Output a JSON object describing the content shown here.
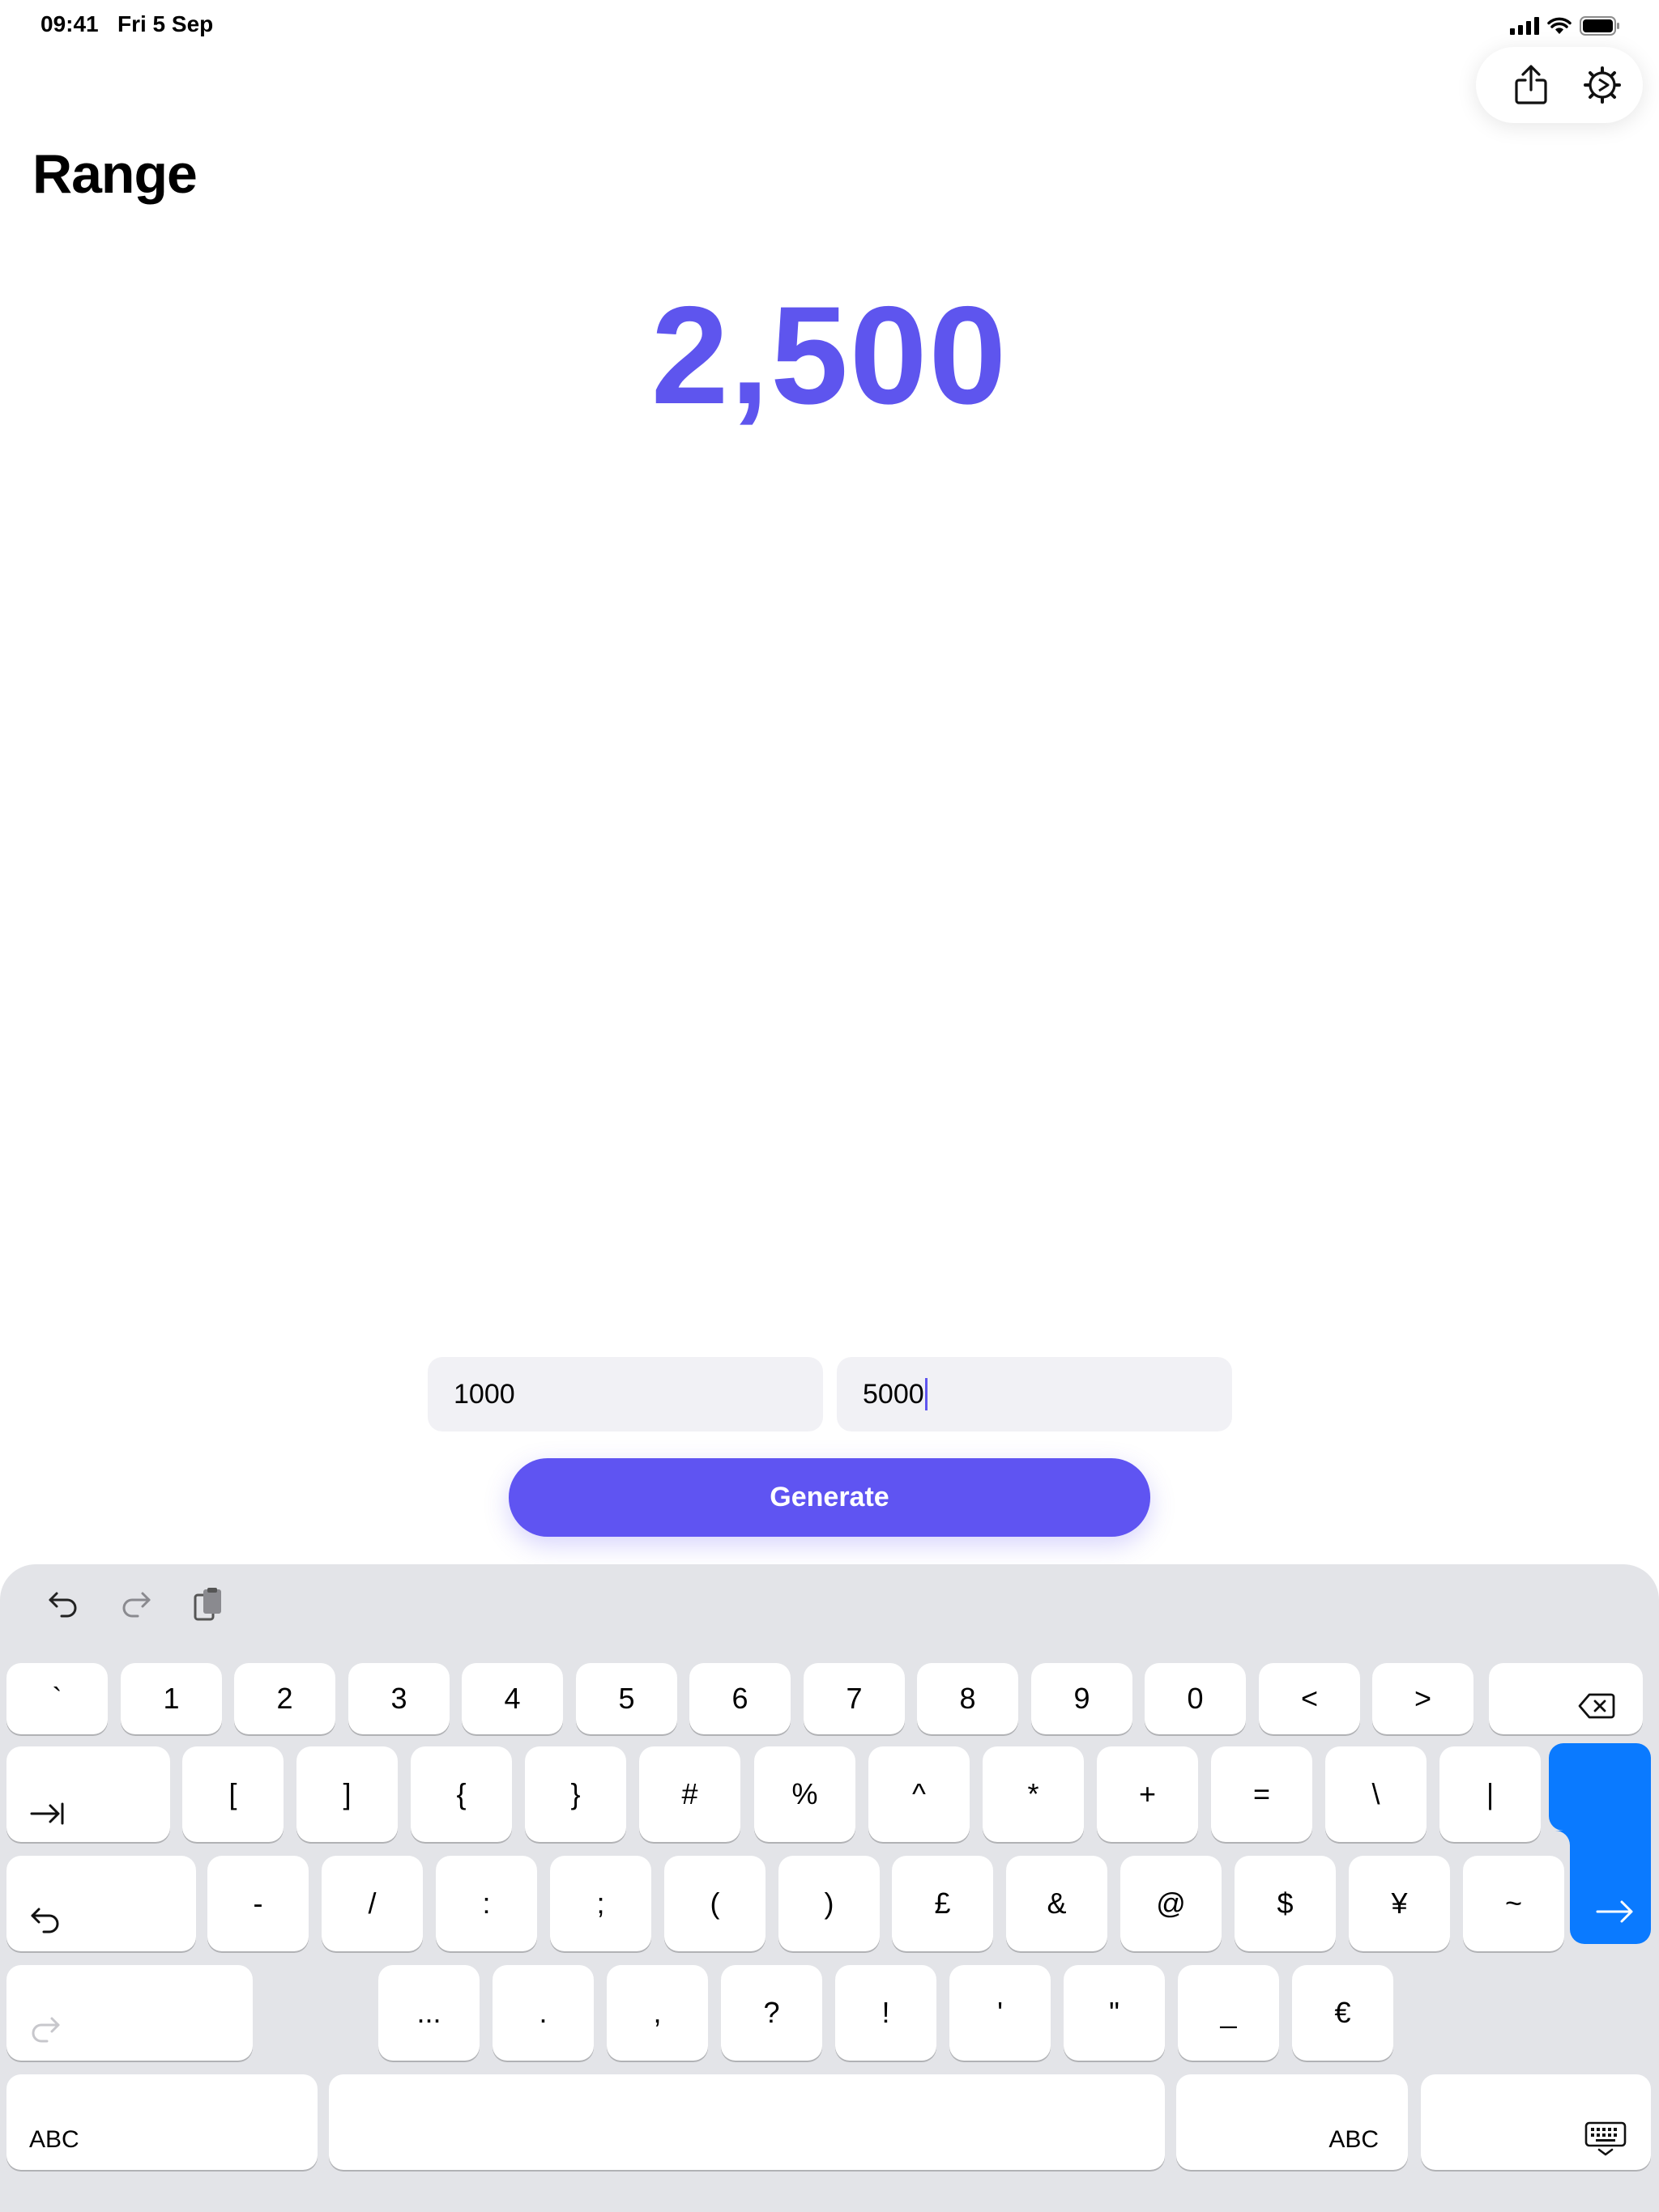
{
  "status_bar": {
    "time": "09:41",
    "date": "Fri 5 Sep"
  },
  "page": {
    "title": "Range",
    "result": "2,500"
  },
  "inputs": {
    "min_value": "1000",
    "max_value": "5000"
  },
  "generate_label": "Generate",
  "colors": {
    "accent": "#5E55EE",
    "keyboard_bg": "#E3E4E8",
    "enter_key": "#0A7AFF"
  },
  "keyboard": {
    "row1": [
      "`",
      "1",
      "2",
      "3",
      "4",
      "5",
      "6",
      "7",
      "8",
      "9",
      "0",
      "<",
      ">"
    ],
    "row2": [
      "[",
      "]",
      "{",
      "}",
      "#",
      "%",
      "^",
      "*",
      "+",
      "=",
      "\\",
      "|"
    ],
    "row3": [
      "-",
      "/",
      ":",
      ";",
      "(",
      ")",
      "£",
      "&",
      "@",
      "$",
      "¥",
      "~"
    ],
    "row4": [
      "...",
      ".",
      ",",
      "?",
      "!",
      "'",
      "\"",
      "_",
      "€"
    ],
    "abc_left": "ABC",
    "abc_right": "ABC",
    "icons": [
      "undo-icon",
      "redo-icon",
      "paste-icon",
      "delete-icon",
      "tab-icon",
      "undo-key-icon",
      "redo-key-icon",
      "enter-arrow-icon",
      "dismiss-keyboard-icon"
    ]
  }
}
